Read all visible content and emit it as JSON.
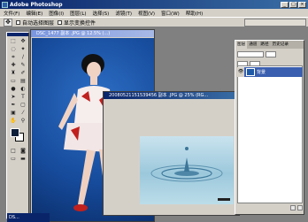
{
  "window": {
    "title": "Adobe Photoshop"
  },
  "menu": [
    "文件(F)",
    "编辑(E)",
    "图像(I)",
    "图层(L)",
    "选择(S)",
    "滤镜(T)",
    "视图(V)",
    "窗口(W)",
    "帮助(H)"
  ],
  "options": {
    "auto_select": "自动选择图层",
    "show_bounds": "显示变换控件"
  },
  "doc1": {
    "title": "DSC_1477 副本 .JPG @ 12.5% (...)"
  },
  "doc2": {
    "title": "20080521151539456 副本 .JPG @ 25% (RG..."
  },
  "layers": {
    "tabs": [
      "图层",
      "通道",
      "路径",
      "历史记录"
    ],
    "layer_name": "背景"
  },
  "minimized": {
    "label": "DS..."
  },
  "colors": {
    "titlebar": "#0a246a",
    "photo_bg": "#1b56a8",
    "water": "#9cc8dc"
  }
}
